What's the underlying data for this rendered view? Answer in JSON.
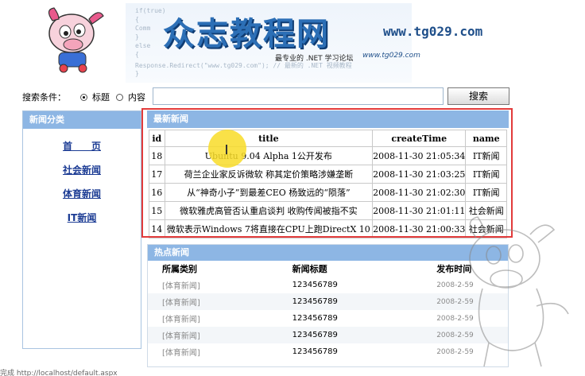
{
  "banner": {
    "title": "众志教程网",
    "url": "www.tg029.com",
    "slogan": "最专业的 .NET 学习论坛",
    "url_small": "www.tg029.com",
    "code_lines": [
      "if(true)",
      "{",
      "    Comm",
      "}",
      "else",
      "{",
      "    Response.Redirect(\"www.tg029.com\"); // 最新的 .NET 视频教程",
      "}"
    ]
  },
  "search": {
    "label": "搜索条件：",
    "option_title": "标题",
    "option_content": "内容",
    "selected": "标题",
    "input_value": "",
    "button_label": "搜索"
  },
  "categories": {
    "header": "新闻分类",
    "items": [
      "首　　页",
      "社会新闻",
      "体育新闻",
      "IT新闻"
    ]
  },
  "latest_news": {
    "header": "最新新闻",
    "columns": [
      "id",
      "title",
      "createTime",
      "name"
    ],
    "rows": [
      {
        "id": "18",
        "title": "Ubuntu 9.04 Alpha 1公开发布",
        "createTime": "2008-11-30 21:05:34",
        "name": "IT新闻"
      },
      {
        "id": "17",
        "title": "荷兰企业家反诉微软 称其定价策略涉嫌垄断",
        "createTime": "2008-11-30 21:03:25",
        "name": "IT新闻"
      },
      {
        "id": "16",
        "title": "从“神奇小子”到最差CEO 杨致远的“陨落”",
        "createTime": "2008-11-30 21:02:30",
        "name": "IT新闻"
      },
      {
        "id": "15",
        "title": "微软雅虎高管否认重启谈判 收购传闻被指不实",
        "createTime": "2008-11-30 21:01:11",
        "name": "社会新闻"
      },
      {
        "id": "14",
        "title": "微软表示Windows 7将直接在CPU上跑DirectX 10",
        "createTime": "2008-11-30 21:00:33",
        "name": "社会新闻"
      }
    ]
  },
  "hot_news": {
    "header": "热点新闻",
    "columns": [
      "所属类别",
      "新闻标题",
      "发布时间"
    ],
    "rows": [
      {
        "category": "[体育新闻]",
        "title": "123456789",
        "date": "2008-2-59"
      },
      {
        "category": "[体育新闻]",
        "title": "123456789",
        "date": "2008-2-59"
      },
      {
        "category": "[体育新闻]",
        "title": "123456789",
        "date": "2008-2-59"
      },
      {
        "category": "[体育新闻]",
        "title": "123456789",
        "date": "2008-2-59"
      },
      {
        "category": "[体育新闻]",
        "title": "123456789",
        "date": "2008-2-59"
      }
    ]
  },
  "status_text": "完成 http://localhost/default.aspx",
  "colors": {
    "panel_header": "#8db6e4",
    "highlight_border": "#e23b3b",
    "link": "#1c3c94",
    "brand": "#2c6fb6"
  }
}
